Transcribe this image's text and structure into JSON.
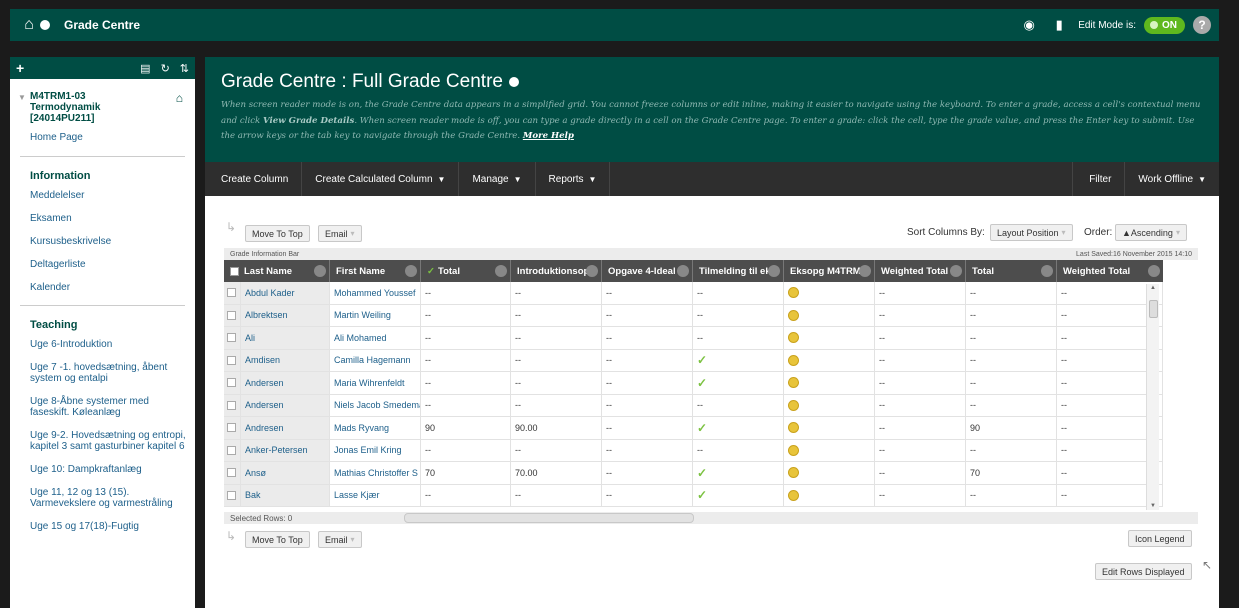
{
  "topbar": {
    "crumb": "Grade Centre",
    "edit_mode_label": "Edit Mode is:",
    "edit_mode_value": "ON",
    "help": "?"
  },
  "sidebar": {
    "course_name": "M4TRM1-03 Termodynamik [24014PU211]",
    "home_page": "Home Page",
    "information_heading": "Information",
    "information_items": [
      "Meddelelser",
      "Eksamen",
      "Kursusbeskrivelse",
      "Deltagerliste",
      "Kalender"
    ],
    "teaching_heading": "Teaching",
    "teaching_items": [
      "Uge 6-Introduktion",
      "Uge 7 -1. hovedsætning, åbent system og entalpi",
      "Uge 8-Åbne systemer med faseskift. Køleanlæg",
      "Uge 9-2. Hovedsætning og entropi, kapitel 3 samt gasturbiner kapitel 6",
      "Uge 10: Dampkraftanlæg",
      "Uge 11, 12 og 13 (15). Varmevekslere og varmestråling",
      "Uge 15 og 17(18)-Fugtig"
    ]
  },
  "header": {
    "title": "Grade Centre : Full Grade Centre",
    "desc_part1": "When screen reader mode is on, the Grade Centre data appears in a simplified grid. You cannot freeze columns or edit inline, making it easier to navigate using the keyboard. To enter a grade, access a cell's contextual menu and click ",
    "desc_bold": "View Grade Details",
    "desc_part2": ". When screen reader mode is off, you can type a grade directly in a cell on the Grade Centre page. To enter a grade: click the cell, type the grade value, and press the Enter key to submit. Use the arrow keys or the tab key to navigate through the Grade Centre. ",
    "more_help": "More Help"
  },
  "actions": {
    "create_column": "Create Column",
    "create_calc": "Create Calculated Column",
    "manage": "Manage",
    "reports": "Reports",
    "filter": "Filter",
    "work_offline": "Work Offline"
  },
  "toolbar": {
    "move_to_top": "Move To Top",
    "email": "Email",
    "sort_label": "Sort Columns By:",
    "sort_value": "Layout Position",
    "order_label": "Order:",
    "order_value": "▲Ascending",
    "info_bar": "Grade Information Bar",
    "last_saved": "Last Saved:16 November 2015 14:10",
    "selected_rows": "Selected Rows: 0",
    "icon_legend": "Icon Legend",
    "edit_rows": "Edit Rows Displayed"
  },
  "grid": {
    "columns": [
      "Last Name",
      "First Name",
      "Total",
      "Introduktionsop",
      "Opgave 4-Ideal",
      "Tilmelding til ek",
      "Eksopg M4TRM",
      "Weighted Total",
      "Total",
      "Weighted Total"
    ],
    "rows": [
      {
        "last": "Abdul Kader",
        "first": "Mohammed Youssef",
        "total": "--",
        "intro": "--",
        "opg": "--",
        "tilm": "--",
        "wt": "--",
        "total2": "--",
        "wt2": "--"
      },
      {
        "last": "Albrektsen",
        "first": "Martin Weiling",
        "total": "--",
        "intro": "--",
        "opg": "--",
        "tilm": "--",
        "wt": "--",
        "total2": "--",
        "wt2": "--"
      },
      {
        "last": "Ali",
        "first": "Ali Mohamed",
        "total": "--",
        "intro": "--",
        "opg": "--",
        "tilm": "--",
        "wt": "--",
        "total2": "--",
        "wt2": "--"
      },
      {
        "last": "Amdisen",
        "first": "Camilla Hagemann",
        "total": "--",
        "intro": "--",
        "opg": "--",
        "tilm": "check",
        "wt": "--",
        "total2": "--",
        "wt2": "--"
      },
      {
        "last": "Andersen",
        "first": "Maria Wihrenfeldt",
        "total": "--",
        "intro": "--",
        "opg": "--",
        "tilm": "check",
        "wt": "--",
        "total2": "--",
        "wt2": "--"
      },
      {
        "last": "Andersen",
        "first": "Niels Jacob Smedemark",
        "total": "--",
        "intro": "--",
        "opg": "--",
        "tilm": "--",
        "wt": "--",
        "total2": "--",
        "wt2": "--"
      },
      {
        "last": "Andresen",
        "first": "Mads Ryvang",
        "total": "90",
        "intro": "90.00",
        "opg": "--",
        "tilm": "check",
        "wt": "--",
        "total2": "90",
        "wt2": "--"
      },
      {
        "last": "Anker-Petersen",
        "first": "Jonas Emil Kring",
        "total": "--",
        "intro": "--",
        "opg": "--",
        "tilm": "--",
        "wt": "--",
        "total2": "--",
        "wt2": "--"
      },
      {
        "last": "Ansø",
        "first": "Mathias Christoffer S",
        "total": "70",
        "intro": "70.00",
        "opg": "--",
        "tilm": "check",
        "wt": "--",
        "total2": "70",
        "wt2": "--"
      },
      {
        "last": "Bak",
        "first": "Lasse Kjær",
        "total": "--",
        "intro": "--",
        "opg": "--",
        "tilm": "check",
        "wt": "--",
        "total2": "--",
        "wt2": "--"
      }
    ]
  },
  "colors": {
    "brand": "#004d44",
    "bar": "#2e2e2e",
    "check": "#7cc242"
  }
}
